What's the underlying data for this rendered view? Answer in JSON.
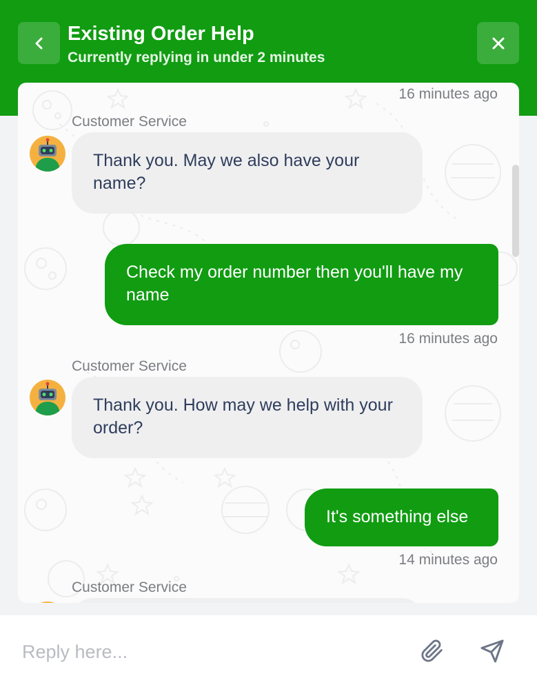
{
  "header": {
    "title": "Existing Order Help",
    "subtitle": "Currently replying in under 2 minutes",
    "back_icon": "chevron-left-icon",
    "close_icon": "close-icon"
  },
  "messages": [
    {
      "type": "timestamp",
      "text": "16 minutes ago"
    },
    {
      "type": "incoming",
      "sender": "Customer Service",
      "text": "Thank you. May we also have your name?"
    },
    {
      "type": "outgoing",
      "text": "Check my order number then you'll have my name",
      "time": "16 minutes ago"
    },
    {
      "type": "incoming",
      "sender": "Customer Service",
      "text": "Thank you. How may we help with your order?"
    },
    {
      "type": "outgoing",
      "text": "It's something else",
      "time": "14 minutes ago"
    },
    {
      "type": "incoming",
      "sender": "Customer Service",
      "text": ""
    }
  ],
  "composer": {
    "placeholder": "Reply here...",
    "attach_icon": "paperclip-icon",
    "send_icon": "send-icon"
  },
  "colors": {
    "brand": "#119c12",
    "incoming_bubble": "#efeff0",
    "text": "#2f3d5c",
    "muted": "#7b7d82"
  }
}
